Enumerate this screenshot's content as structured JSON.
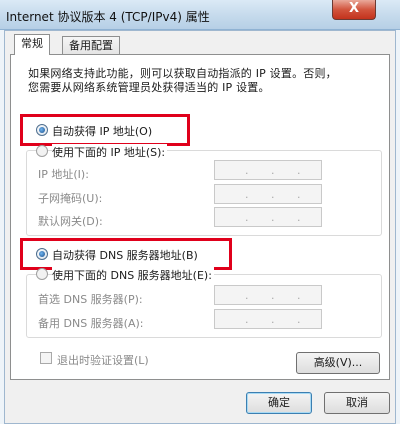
{
  "window": {
    "title": "Internet 协议版本 4 (TCP/IPv4) 属性",
    "close": "X"
  },
  "tabs": [
    {
      "label": "常规",
      "active": true
    },
    {
      "label": "备用配置",
      "active": false
    }
  ],
  "description": {
    "line1": "如果网络支持此功能，则可以获取自动指派的 IP 设置。否则，",
    "line2": "您需要从网络系统管理员处获得适当的 IP 设置。"
  },
  "ip_section": {
    "auto_label": "自动获得 IP 地址(O)",
    "manual_label": "使用下面的 IP 地址(S):",
    "fields": [
      {
        "label": "IP 地址(I):"
      },
      {
        "label": "子网掩码(U):"
      },
      {
        "label": "默认网关(D):"
      }
    ]
  },
  "dns_section": {
    "auto_label": "自动获得 DNS 服务器地址(B)",
    "manual_label": "使用下面的 DNS 服务器地址(E):",
    "fields": [
      {
        "label": "首选 DNS 服务器(P):"
      },
      {
        "label": "备用 DNS 服务器(A):"
      }
    ]
  },
  "validate_label": "退出时验证设置(L)",
  "buttons": {
    "advanced": "高级(V)...",
    "ok": "确定",
    "cancel": "取消"
  },
  "colors": {
    "highlight_box": "#e0001b",
    "selected_radio": "#1c4f8a"
  }
}
